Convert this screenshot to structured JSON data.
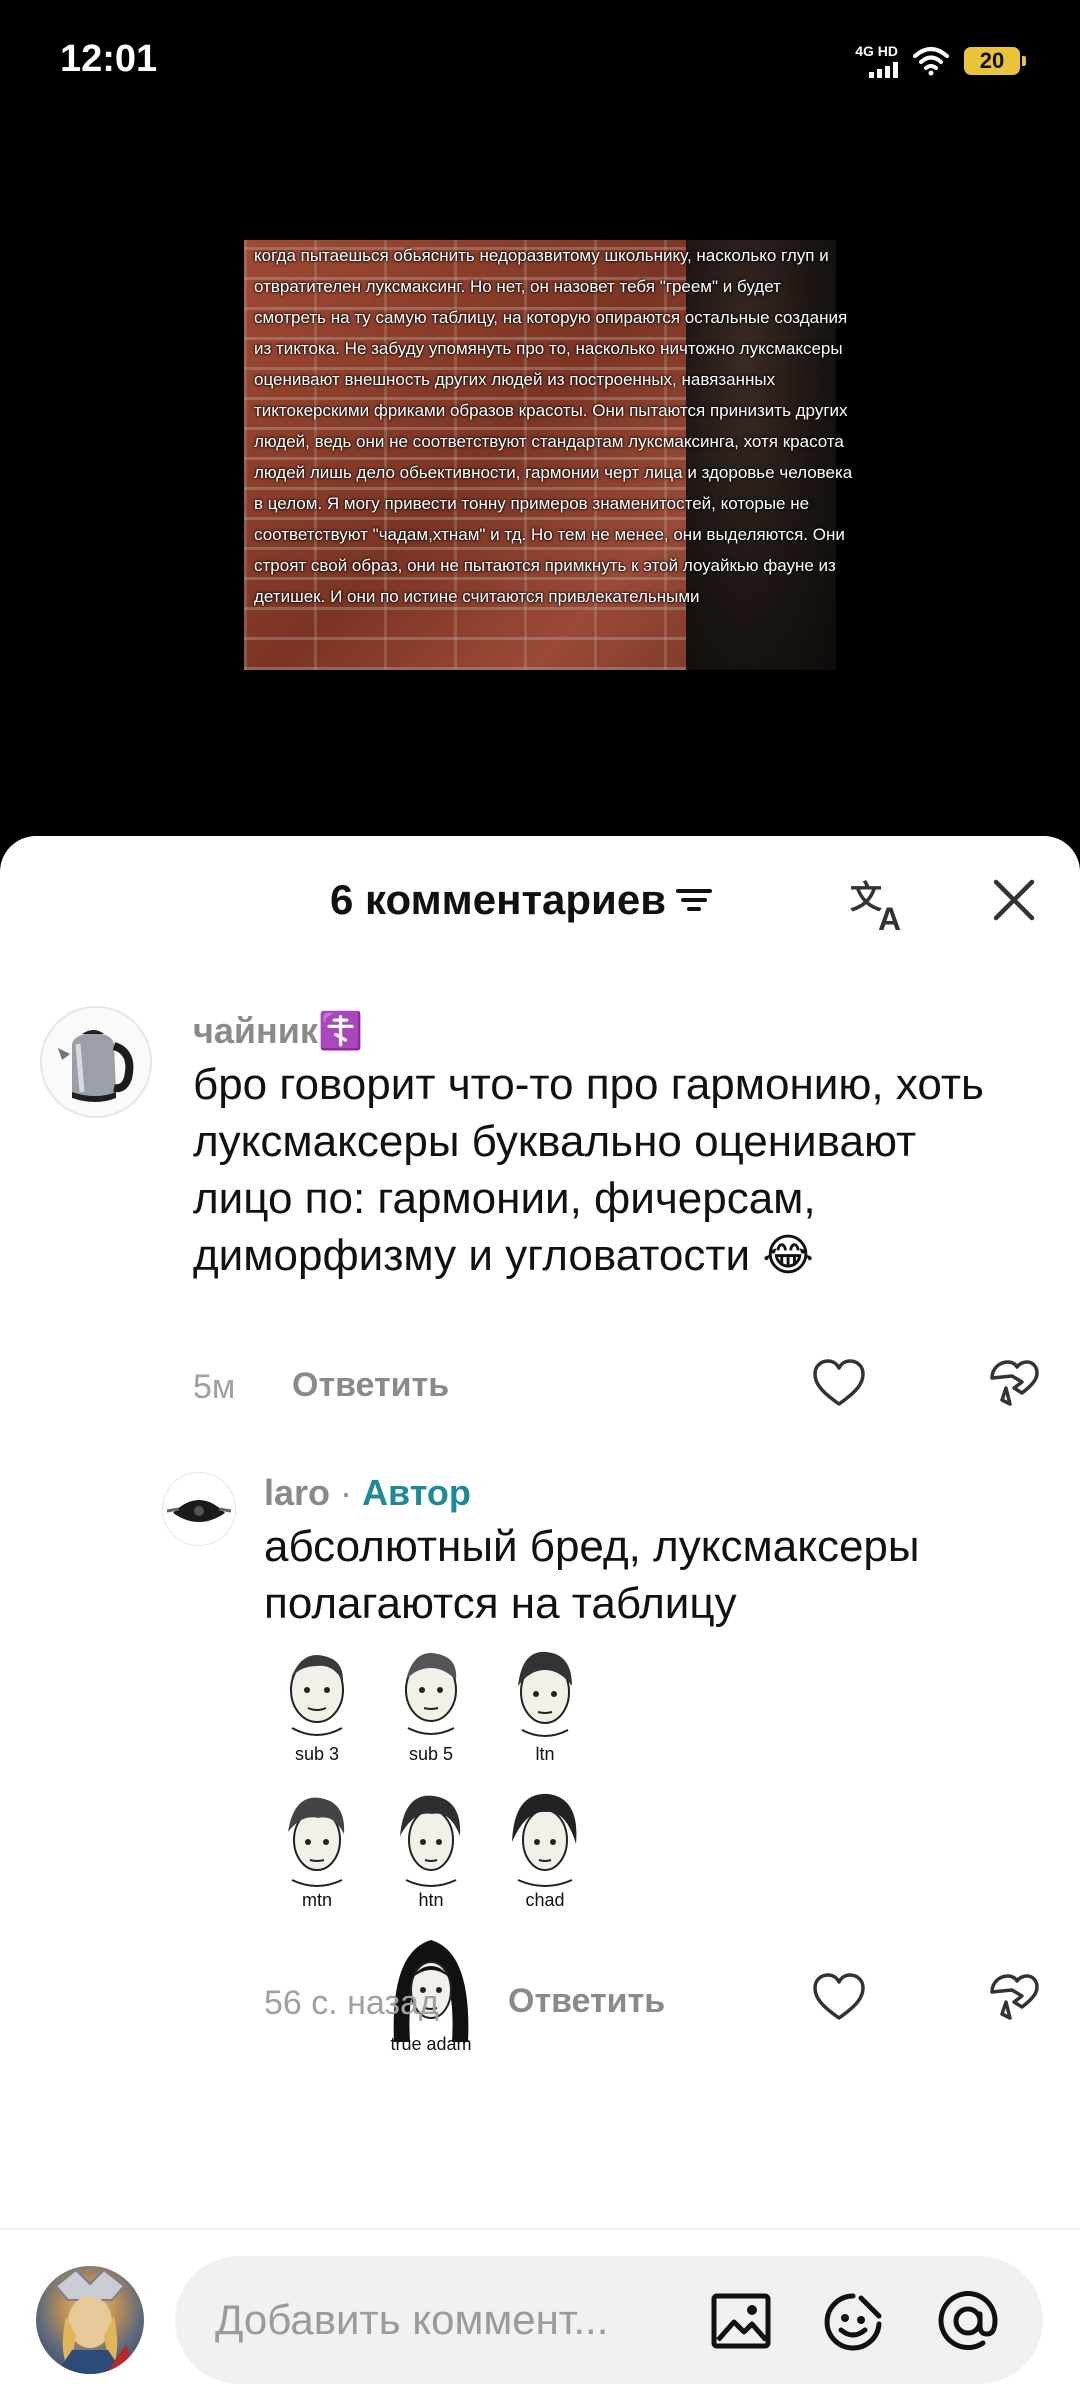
{
  "status_bar": {
    "time": "12:01",
    "network_label": "4G HD",
    "battery_level": "20"
  },
  "video": {
    "caption": "когда пытаешься обьяснить недоразвитому школьнику, насколько глуп и отвратителен луксмаксинг. Но нет, он назовет тебя \"греем\" и будет смотреть на ту самую таблицу, на которую опираются остальные создания из тиктока. Не забуду упомянуть про то, насколько ничтожно луксмаксеры оценивают внешность других людей из построенных, навязанных тиктокерскими фриками образов красоты. Они пытаются принизить других людей, ведь они не соответствуют стандартам луксмаксинга, хотя красота людей лишь дело обьективности, гармонии черт лица и здоровье человека в целом. Я могу привести тонну примеров знаменитостей, которые не соответствуют \"чадам,хтнам\" и тд. Но тем не менее, они выделяются. Они строят свой образ, они не пытаются примкнуть к этой лоуайкью фауне из детишек. И они по истине считаются привлекательными"
  },
  "sheet": {
    "title": "6 комментариев",
    "icons": {
      "filter": "filter-icon",
      "translate": "translate-icon",
      "close": "close-icon"
    }
  },
  "comments": [
    {
      "author": "чайник☦️",
      "text": "бро говорит что-то про гармонию, хоть луксмаксеры буквально оценивают лицо по: гармонии, фичерсам, диморфизму и угловатости 😂",
      "time": "5м",
      "reply_label": "Ответить"
    }
  ],
  "reply": {
    "author": "laro",
    "author_separator": "·",
    "badge": "Автор",
    "text": "абсолютный бред, луксмаксеры полагаются на таблицу",
    "image_labels": [
      "sub 3",
      "sub 5",
      "ltn",
      "mtn",
      "htn",
      "chad",
      "true adam"
    ],
    "time": "56 с. назад",
    "reply_label": "Ответить"
  },
  "bottom_bar": {
    "placeholder": "Добавить коммент...",
    "icons": [
      "image-icon",
      "emoji-icon",
      "mention-icon"
    ]
  },
  "colors": {
    "author_badge": "#1f8a95",
    "battery": "#e7c43a"
  }
}
